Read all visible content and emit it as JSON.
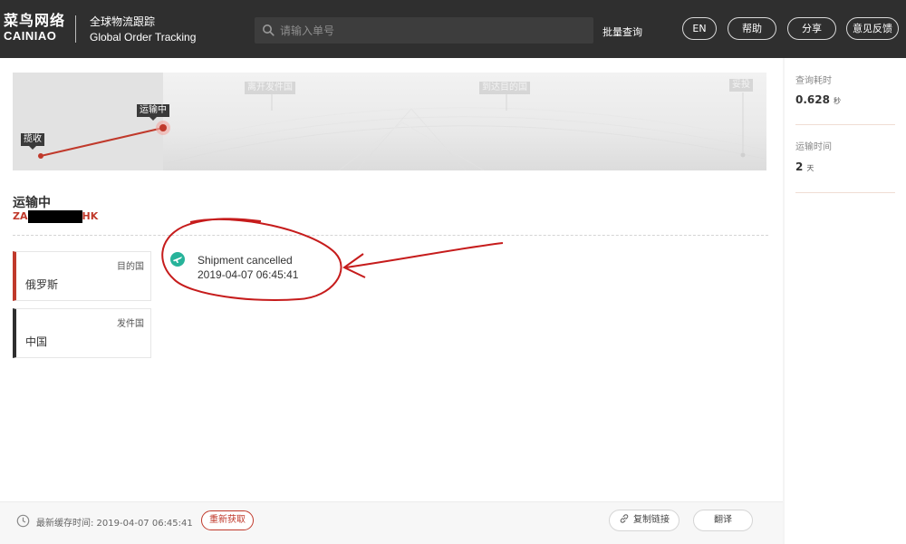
{
  "header": {
    "brand_cn": "菜鸟网络",
    "brand_en": "CAINIAO",
    "product_cn": "全球物流跟踪",
    "product_en": "Global Order Tracking",
    "search_placeholder": "请输入单号",
    "batch_query": "批量查询",
    "buttons": {
      "lang": "EN",
      "help": "帮助",
      "share": "分享",
      "feedback": "意见反馈"
    }
  },
  "map": {
    "stages": [
      "揽收",
      "运输中",
      "离开发件国",
      "到达目的国",
      "妥投"
    ]
  },
  "shipment": {
    "status": "运输中",
    "tracking_prefix": "ZA",
    "tracking_suffix": "HK",
    "destination_label": "目的国",
    "destination": "俄罗斯",
    "origin_label": "发件国",
    "origin": "中国"
  },
  "events": [
    {
      "text": "Shipment cancelled",
      "time": "2019-04-07 06:45:41"
    }
  ],
  "footer": {
    "cache_text": "最新缓存时间: 2019-04-07 06:45:41",
    "refresh": "重新获取",
    "copy_link": "复制链接",
    "translate": "翻译"
  },
  "side": {
    "query_time_label": "查询耗时",
    "query_time_value": "0.628",
    "query_time_unit": "秒",
    "transit_label": "运输时间",
    "transit_value": "2",
    "transit_unit": "天"
  },
  "colors": {
    "accent": "#c0392b",
    "header_bg": "#2f2f2f",
    "event_icon": "#27b39a"
  },
  "icons": {
    "search": "search-icon",
    "event": "plane-icon",
    "clock": "clock-icon",
    "link": "link-icon"
  }
}
